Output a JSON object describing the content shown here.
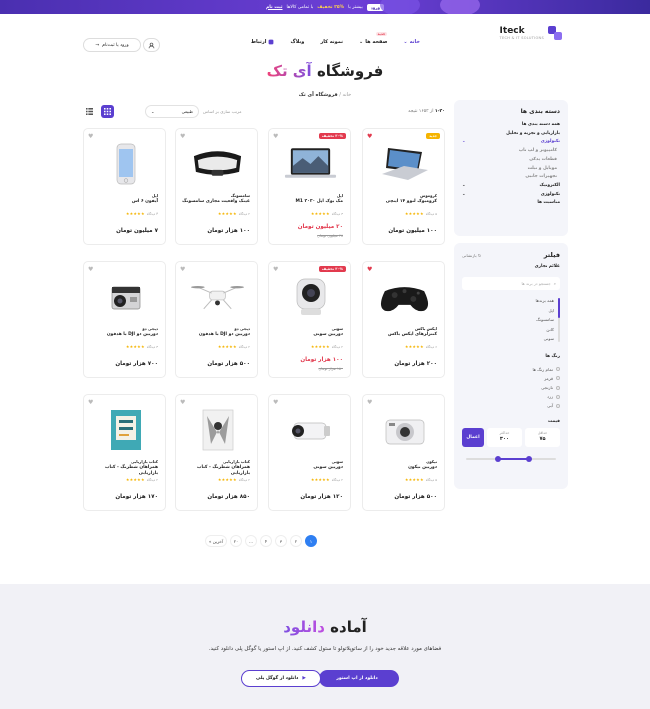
{
  "promo": {
    "before": "بیشتر با",
    "discount": "۲۵% تخفیف",
    "after": "با تمامی کالاها",
    "link": "ثبت نام",
    "button": "ورود"
  },
  "header": {
    "logo_name": "Iteck",
    "logo_tagline": "TECH & IT SOLUTIONS",
    "nav": [
      {
        "label": "خانه"
      },
      {
        "label": "صفحه ها",
        "badge": "جدید"
      },
      {
        "label": "نمونه کار"
      },
      {
        "label": "وبلاگ"
      },
      {
        "label": "ارتباط"
      }
    ],
    "login": "ورود یا ثبت‌نام",
    "accent": "#5b3fd0"
  },
  "page": {
    "title_a": "فروشگاه",
    "title_b": "آی تک",
    "crumb_home": "خانه",
    "crumb_sep": "/",
    "crumb_current": "فروشگاه آی تک"
  },
  "toolbar": {
    "count_prefix": "۱-۲۰",
    "count_of": "از ۱۶۵۳ نتیجه",
    "sort_label": "مرتب سازی بر اساس",
    "sort_value": "طبیعی"
  },
  "categories": {
    "title": "دسته بندی ها",
    "items": [
      {
        "label": "همه دسته بندی ها",
        "state": "normal"
      },
      {
        "label": "بازاریابی و تجزیه و تحلیل",
        "state": "normal"
      },
      {
        "label": "تکنولوژی",
        "state": "selected",
        "caret": "⌄"
      },
      {
        "label": "کامپیوتر و لپ تاپ",
        "state": "sub"
      },
      {
        "label": "قطعات یدکی",
        "state": "sub"
      },
      {
        "label": "موبایل و تبلت",
        "state": "sub"
      },
      {
        "label": "تجهیزات جانبی",
        "state": "sub"
      },
      {
        "label": "الکترونیک",
        "state": "normal",
        "caret": "⌄"
      },
      {
        "label": "تکنولوژی",
        "state": "normal",
        "caret": "⌄"
      },
      {
        "label": "مناسبت ها",
        "state": "normal"
      }
    ]
  },
  "filter": {
    "title": "فیلتر",
    "reset": "بازنشانی",
    "brand_heading": "علائم تجاری",
    "search_placeholder": "جستجو در برند ها",
    "brands": [
      "همه برندها",
      "اپل",
      "سامسونگ",
      "کانن",
      "سونی"
    ],
    "color_heading": "رنگ ها",
    "colors": [
      "تمام رنگ ها",
      "قرمز",
      "نارنجی",
      "زرد",
      "آبی"
    ],
    "price_heading": "قیمت",
    "min_label": "حداقل",
    "min_value": "۷۵",
    "max_label": "حداکثر",
    "max_value": "۳۰۰",
    "apply": "اعمال",
    "slider_low": 0.3,
    "slider_high": 0.65
  },
  "products": [
    {
      "brand": "کروموس",
      "name": "کرومبوک لنوو ۱۴ اینچی",
      "reviews": "۵ دیدگاه",
      "price": "۱۰۰ میلیون تومان",
      "badge": "جدید",
      "badge_color": "#f5b400",
      "heart": "on",
      "img": "laptop-convertible"
    },
    {
      "brand": "اپل",
      "name": "مک بوک اپل ۲۰۲۰ M1",
      "reviews": "۳ دیدگاه",
      "price": "۲۰ میلیون تومان",
      "sale": true,
      "old": "۲۸ میلیون تومان",
      "badge": "۳۰% تخفیف",
      "badge_color": "#e23a4e",
      "heart": "off",
      "img": "macbook"
    },
    {
      "brand": "سامسونگ",
      "name": "عینک واقعیت مجازی سامسونگ",
      "reviews": "۲ دیدگاه",
      "price": "۱۰۰ هزار تومان",
      "heart": "off",
      "img": "vr-headset"
    },
    {
      "brand": "اپل",
      "name": "آیفون ۶ اس",
      "reviews": "۴ دیدگاه",
      "price": "۷ میلیون تومان",
      "heart": "off",
      "img": "iphone"
    },
    {
      "brand": "ایکس باکس",
      "name": "کنترلرهای ایکس باکس",
      "reviews": "۶ دیدگاه",
      "price": "۲۰۰ هزار تومان",
      "heart": "on",
      "img": "controller"
    },
    {
      "brand": "سونی",
      "name": "دوربین سونی",
      "reviews": "۲ دیدگاه",
      "price": "۱۰۰ هزار تومان",
      "sale": true,
      "old": "۱۵۰ هزار تومان",
      "badge": "۳۰% تخفیف",
      "badge_color": "#e23a4e",
      "heart": "off",
      "img": "security-cam"
    },
    {
      "brand": "دیجی دو",
      "name": "دوربین دو DJI با هدفون",
      "reviews": "۲ دیدگاه",
      "price": "۵۰۰ هزار تومان",
      "heart": "off",
      "img": "drone"
    },
    {
      "brand": "دیجی دو",
      "name": "دوربین دو DJI با هدفون",
      "reviews": "۳ دیدگاه",
      "price": "۷۰۰ هزار تومان",
      "heart": "off",
      "img": "action-cam"
    },
    {
      "brand": "نیکون",
      "name": "دوربین نیکون",
      "reviews": "۵ دیدگاه",
      "price": "۵۰۰ هزار تومان",
      "heart": "off",
      "img": "compact-cam"
    },
    {
      "brand": "سونی",
      "name": "دوربین سونی",
      "reviews": "۲ دیدگاه",
      "price": "۱۲۰ هزار تومان",
      "heart": "off",
      "img": "sony-cam"
    },
    {
      "brand": "کتاب بازاریابی",
      "name": "همراهان شطرنگ - کتاب بازاریابی",
      "reviews": "۲ دیدگاه",
      "price": "۸۵۰ هزار تومان",
      "heart": "off",
      "img": "book-white"
    },
    {
      "brand": "کتاب بازاریابی",
      "name": "همراهان شطرنگ - کتاب بازاریابی",
      "reviews": "۲ دیدگاه",
      "price": "۱۷۰ هزار تومان",
      "heart": "off",
      "img": "book-teal"
    }
  ],
  "pager": {
    "pages": [
      "۱",
      "۲",
      "۳",
      "۴",
      "...",
      "۲۰"
    ],
    "last": "آخرین »",
    "active": 0
  },
  "download": {
    "title_a": "آماده",
    "title_b": "دانلود",
    "text": "فضاهای مورد علاقه جدید خود را از ساتوپلاتولو تا ستول کشف کنید. از اپ استور یا گوگل پلی دانلود کنید.",
    "app_store": "دانلود از اپ استور",
    "google_play": "دانلود از گوگل پلی"
  }
}
